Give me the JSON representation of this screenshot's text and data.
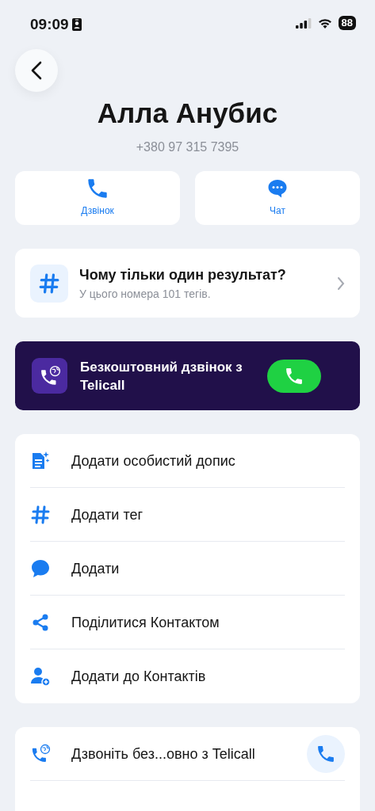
{
  "status_bar": {
    "time": "09:09",
    "battery": "88"
  },
  "contact": {
    "name": "Алла Анубис",
    "phone": "+380 97 315 7395"
  },
  "actions": [
    {
      "label": "Дзвінок",
      "kind": "call"
    },
    {
      "label": "Чат",
      "kind": "chat"
    }
  ],
  "info_card": {
    "title": "Чому тільки один результат?",
    "subtitle": "У цього номера 101 тегів."
  },
  "promo": {
    "text": "Безкоштовний дзвінок з Telicall"
  },
  "menu": [
    {
      "label": "Додати особистий допис",
      "kind": "note"
    },
    {
      "label": "Додати тег",
      "kind": "tag"
    },
    {
      "label": "Додати",
      "kind": "comment"
    },
    {
      "label": "Поділитися Контактом",
      "kind": "share"
    },
    {
      "label": "Додати до Контактів",
      "kind": "add_contact"
    }
  ],
  "bottom_menu": [
    {
      "label": "Дзвоніть без...овно з Telicall",
      "kind": "telicall"
    }
  ]
}
